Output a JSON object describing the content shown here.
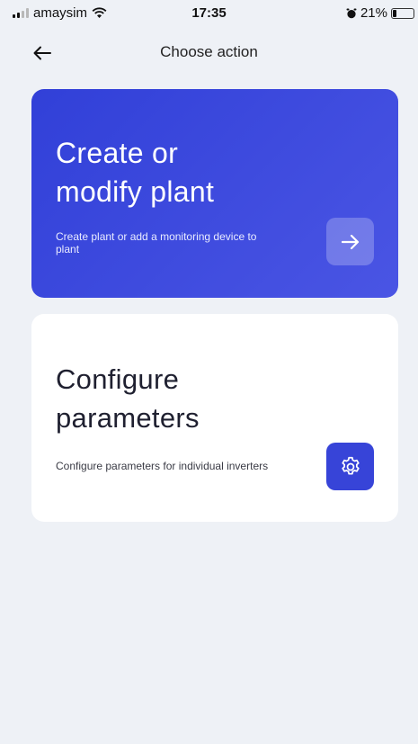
{
  "status_bar": {
    "carrier": "amaysim",
    "time": "17:35",
    "battery_text": "21%",
    "battery_level": 0.21
  },
  "nav": {
    "title": "Choose action",
    "back_icon": "arrow-left-icon"
  },
  "cards": [
    {
      "title_line1": "Create or",
      "title_line2": "modify plant",
      "description": "Create plant or add a monitoring device to plant",
      "action_icon": "arrow-right-icon"
    },
    {
      "title_line1": "Configure",
      "title_line2": "parameters",
      "description": "Configure parameters for individual inverters",
      "action_icon": "gear-icon"
    }
  ],
  "colors": {
    "accent": "#3744d8",
    "background": "#eef1f6",
    "card": "#ffffff"
  }
}
